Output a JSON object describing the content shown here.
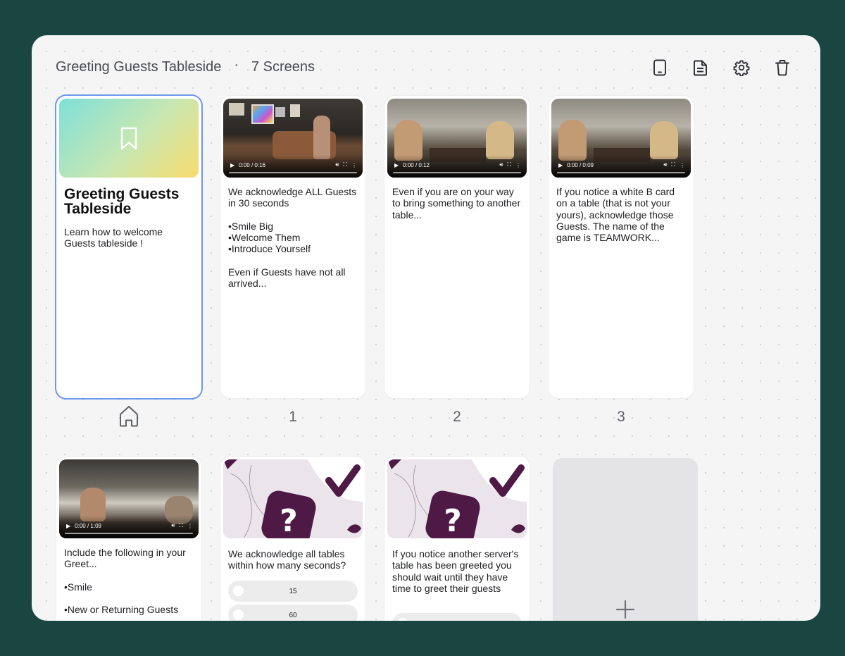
{
  "header": {
    "title": "Greeting Guests Tableside",
    "separator": "·",
    "screens_count": "7 Screens"
  },
  "toolbar": {
    "icons": [
      "phone-preview-icon",
      "document-icon",
      "gear-icon",
      "trash-icon"
    ]
  },
  "colors": {
    "background": "#1b4540",
    "selected_outline": "#6e97ee",
    "quiz_accent": "#4e1a45"
  },
  "cover": {
    "icon": "bookmark-icon",
    "title": "Greeting Guests Tableside",
    "description": "Learn how to welcome Guests tableside !",
    "label_icon": "home-icon"
  },
  "screens": [
    {
      "label": "1",
      "type": "video",
      "time": "0:00 / 0:16",
      "text": " We acknowledge ALL Guests in 30 seconds\n\n•Smile Big\n•Welcome Them\n•Introduce Yourself\n\nEven if Guests have not all arrived..."
    },
    {
      "label": "2",
      "type": "video",
      "time": "0:00 / 0:12",
      "text": "Even if you are on your way to bring something to another table..."
    },
    {
      "label": "3",
      "type": "video",
      "time": "0:00 / 0:09",
      "text": "If you notice a white B card on a table (that is not your yours), acknowledge those Guests. The name of the game is TEAMWORK..."
    },
    {
      "label": "",
      "type": "video",
      "time": "0:00 / 1:09",
      "text": "Include the following in your Greet...\n\n•Smile\n\n•New or Returning Guests"
    },
    {
      "label": "",
      "type": "quiz",
      "text": "We acknowledge all tables within how many seconds?",
      "options": [
        "15",
        "60"
      ]
    },
    {
      "label": "",
      "type": "quiz",
      "text": "If you notice another server's table has been greeted you should wait until they have time to greet their guests"
    }
  ],
  "add_card": {
    "icon": "plus-icon"
  }
}
